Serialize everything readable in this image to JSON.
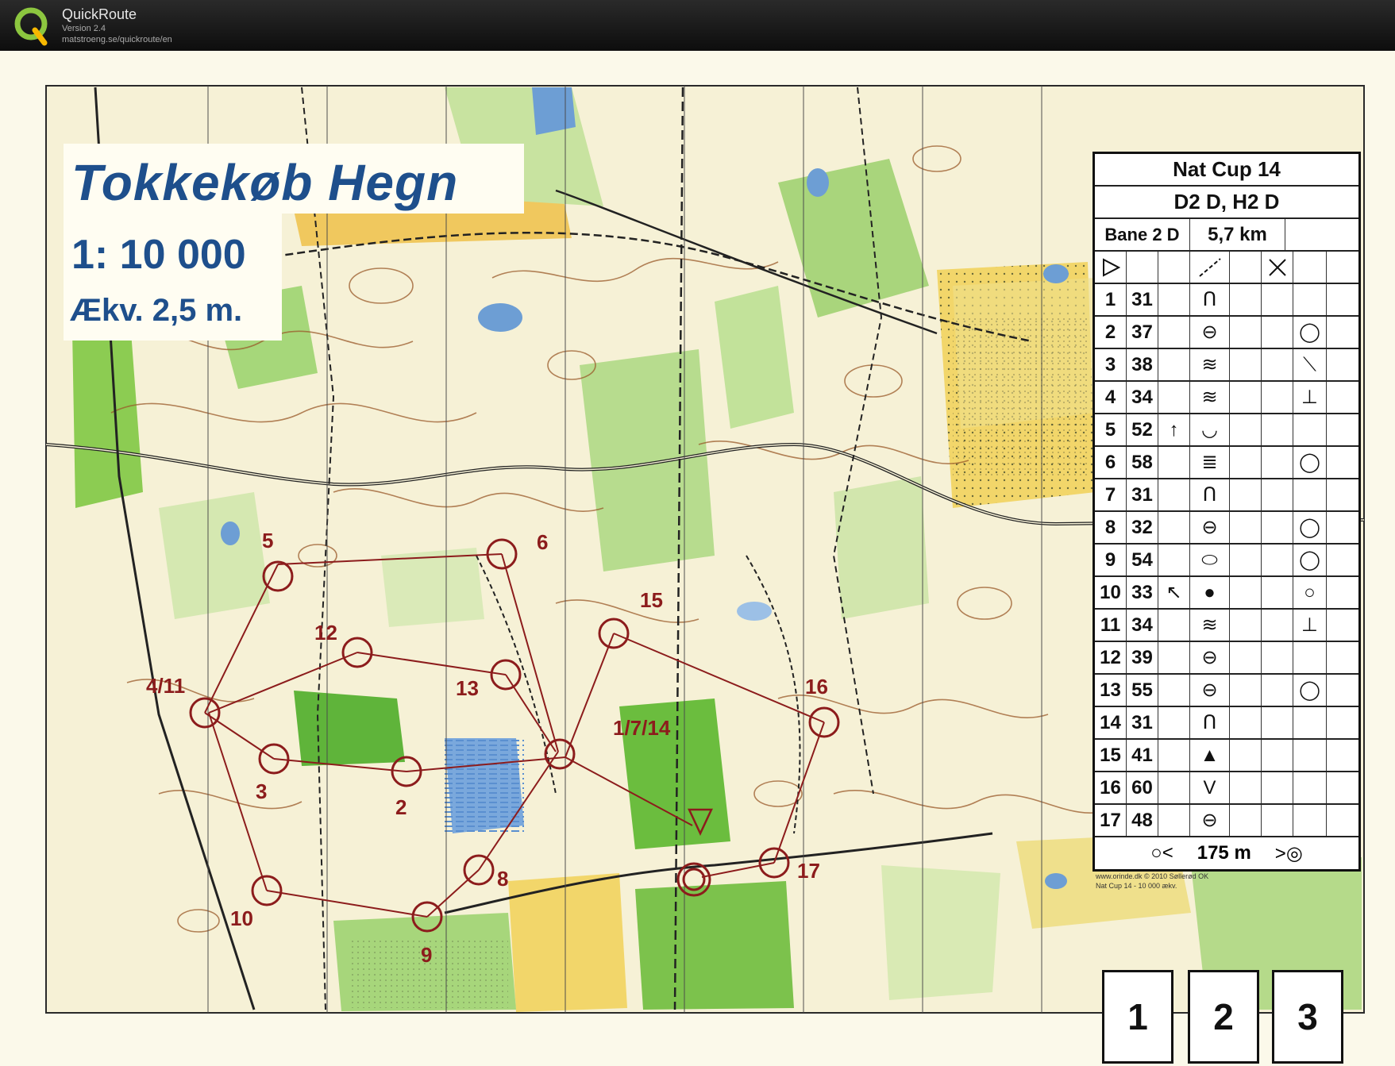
{
  "app": {
    "name": "QuickRoute",
    "version": "Version 2.4",
    "url": "matstroeng.se/quickroute/en"
  },
  "map": {
    "title": "Tokkekøb Hegn",
    "scale": "1: 10 000",
    "contour_interval": "Ækv. 2,5 m.",
    "colors": {
      "paper": "#fbf9ea",
      "forest_green": "#a8d27a",
      "dark_green": "#6bbd3e",
      "yellow": "#f2d66a",
      "water": "#6d9ed4",
      "course": "#8c1c1c",
      "contours": "#9a5a2a"
    },
    "controls": [
      {
        "label": "5"
      },
      {
        "label": "6"
      },
      {
        "label": "15"
      },
      {
        "label": "12"
      },
      {
        "label": "13"
      },
      {
        "label": "4/11"
      },
      {
        "label": "16"
      },
      {
        "label": "1/7/14"
      },
      {
        "label": "3"
      },
      {
        "label": "2"
      },
      {
        "label": "8"
      },
      {
        "label": "17"
      },
      {
        "label": "10"
      },
      {
        "label": "9"
      }
    ],
    "print_note": [
      "www.orinde.dk  © 2010 Søllerød OK",
      "Nat Cup 14 - 10 000 ækv."
    ]
  },
  "control_card": {
    "event": "Nat Cup 14",
    "classes": "D2 D, H2 D",
    "course": "Bane 2 D",
    "length": "5,7 km",
    "start_symbols": [
      "start-triangle",
      "",
      "",
      "line-feature",
      "",
      "crossing"
    ],
    "rows": [
      {
        "num": "1",
        "code": "31",
        "dir": "",
        "feature": "Ո",
        "where": ""
      },
      {
        "num": "2",
        "code": "37",
        "dir": "",
        "feature": "⊖",
        "where": "◯"
      },
      {
        "num": "3",
        "code": "38",
        "dir": "",
        "feature": "≋",
        "where": "⟍"
      },
      {
        "num": "4",
        "code": "34",
        "dir": "",
        "feature": "≋",
        "where": "⊥"
      },
      {
        "num": "5",
        "code": "52",
        "dir": "↑",
        "feature": "◡",
        "where": ""
      },
      {
        "num": "6",
        "code": "58",
        "dir": "",
        "feature": "≣",
        "where": "◯"
      },
      {
        "num": "7",
        "code": "31",
        "dir": "",
        "feature": "Ո",
        "where": ""
      },
      {
        "num": "8",
        "code": "32",
        "dir": "",
        "feature": "⊖",
        "where": "◯"
      },
      {
        "num": "9",
        "code": "54",
        "dir": "",
        "feature": "⬭",
        "where": "◯"
      },
      {
        "num": "10",
        "code": "33",
        "dir": "↖",
        "feature": "●",
        "where": "○"
      },
      {
        "num": "11",
        "code": "34",
        "dir": "",
        "feature": "≋",
        "where": "⊥"
      },
      {
        "num": "12",
        "code": "39",
        "dir": "",
        "feature": "⊖",
        "where": ""
      },
      {
        "num": "13",
        "code": "55",
        "dir": "",
        "feature": "⊖",
        "where": "◯"
      },
      {
        "num": "14",
        "code": "31",
        "dir": "",
        "feature": "Ո",
        "where": ""
      },
      {
        "num": "15",
        "code": "41",
        "dir": "",
        "feature": "▲",
        "where": ""
      },
      {
        "num": "16",
        "code": "60",
        "dir": "",
        "feature": "V",
        "where": ""
      },
      {
        "num": "17",
        "code": "48",
        "dir": "",
        "feature": "⊖",
        "where": ""
      }
    ],
    "finish": {
      "left": "○<",
      "distance": "175 m",
      "right": ">◎"
    }
  },
  "split_boxes": [
    "1",
    "2",
    "3"
  ]
}
